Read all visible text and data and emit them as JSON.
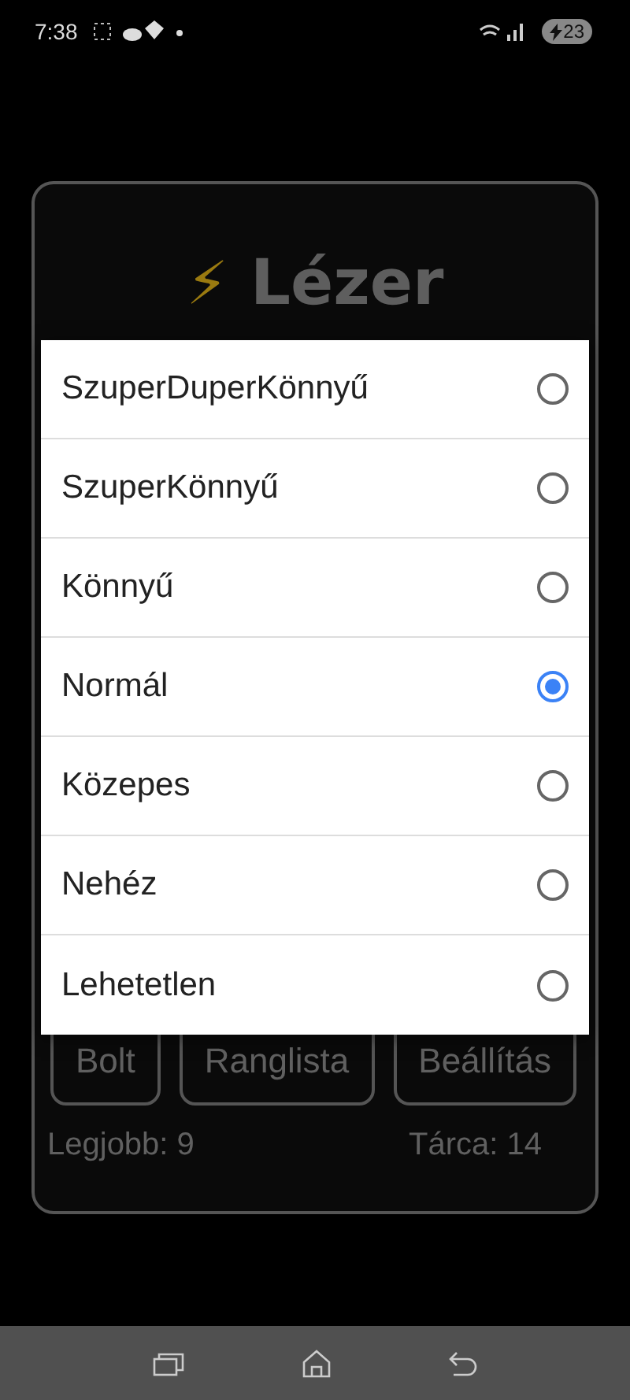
{
  "status_bar": {
    "time": "7:38",
    "battery": "23"
  },
  "title": {
    "icon": "⚡",
    "text": "Lézer"
  },
  "menu_buttons": [
    {
      "label": "Bolt"
    },
    {
      "label": "Ranglista"
    },
    {
      "label": "Beállítás"
    }
  ],
  "stats": {
    "best": "Legjobb: 9",
    "wallet": "Tárca: 14"
  },
  "difficulty_dialog": {
    "options": [
      {
        "label": "SzuperDuperKönnyű",
        "selected": false
      },
      {
        "label": "SzuperKönnyű",
        "selected": false
      },
      {
        "label": "Könnyű",
        "selected": false
      },
      {
        "label": "Normál",
        "selected": true
      },
      {
        "label": "Közepes",
        "selected": false
      },
      {
        "label": "Nehéz",
        "selected": false
      },
      {
        "label": "Lehetetlen",
        "selected": false
      }
    ]
  }
}
